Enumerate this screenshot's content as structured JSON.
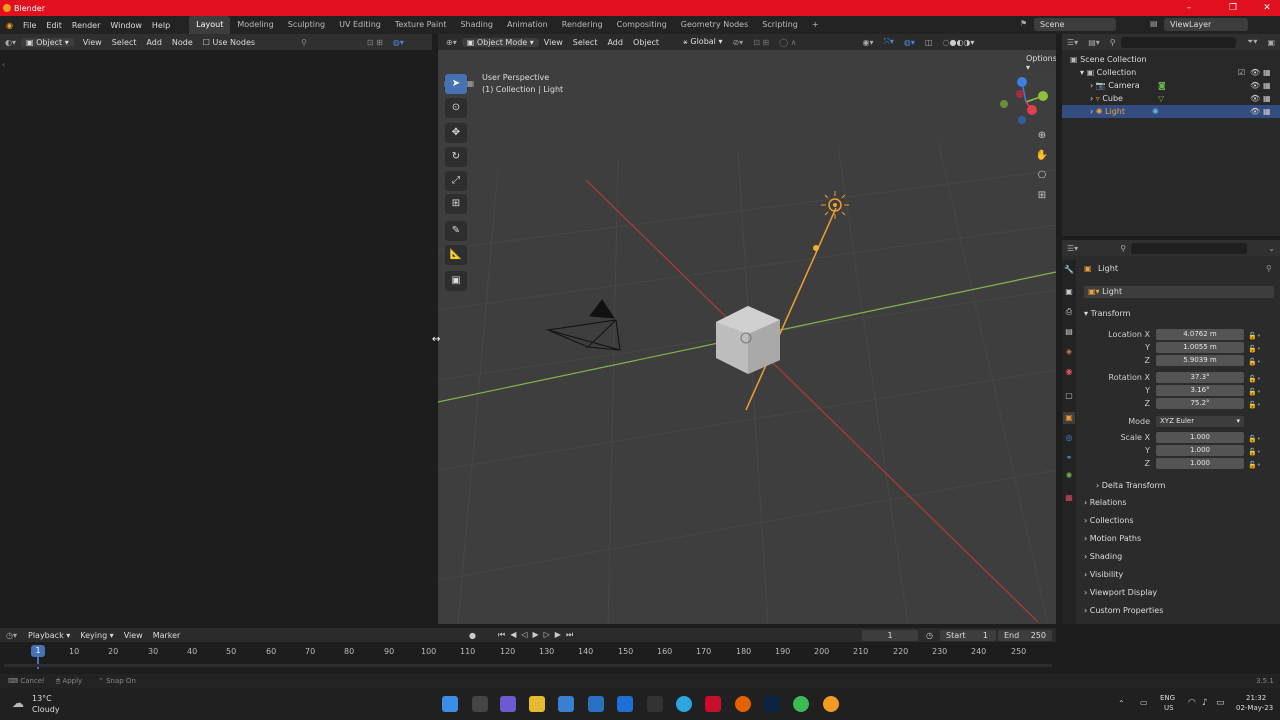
{
  "window": {
    "title": "Blender",
    "minimize": "–",
    "maximize": "❐",
    "close": "✕"
  },
  "menubar": {
    "menus": [
      "File",
      "Edit",
      "Render",
      "Window",
      "Help"
    ],
    "workspaces": [
      "Layout",
      "Modeling",
      "Sculpting",
      "UV Editing",
      "Texture Paint",
      "Shading",
      "Animation",
      "Rendering",
      "Compositing",
      "Geometry Nodes",
      "Scripting"
    ],
    "add_workspace": "+",
    "scene": "Scene",
    "view_layer": "ViewLayer"
  },
  "node_editor": {
    "object": "Object",
    "menus": [
      "View",
      "Select",
      "Add",
      "Node"
    ],
    "use_nodes": "Use Nodes"
  },
  "viewport": {
    "mode": "Object Mode",
    "menus": [
      "View",
      "Select",
      "Add",
      "Object"
    ],
    "orientation": "Global",
    "options": "Options",
    "perspective": "User Perspective",
    "collection_info": "(1) Collection | Light"
  },
  "outliner": {
    "rows": [
      {
        "label": "Scene Collection",
        "icon": "scene-collection-icon"
      },
      {
        "label": "Collection",
        "icon": "collection-icon"
      },
      {
        "label": "Camera",
        "icon": "camera-icon"
      },
      {
        "label": "Cube",
        "icon": "mesh-icon"
      },
      {
        "label": "Light",
        "icon": "light-icon"
      }
    ]
  },
  "properties": {
    "object_name": "Light",
    "datablock": "Light",
    "transform_title": "Transform",
    "location_label": "Location X",
    "location": [
      "4.0762 m",
      "1.0055 m",
      "5.9039 m"
    ],
    "rotation_label": "Rotation X",
    "rotation": [
      "37.3°",
      "3.16°",
      "75.2°"
    ],
    "mode_label": "Mode",
    "mode_value": "XYZ Euler",
    "scale_label": "Scale X",
    "scale": [
      "1.000",
      "1.000",
      "1.000"
    ],
    "axis_y": "Y",
    "axis_z": "Z",
    "delta_transform": "Delta Transform",
    "panels": [
      "Relations",
      "Collections",
      "Motion Paths",
      "Shading",
      "Visibility",
      "Viewport Display",
      "Custom Properties"
    ]
  },
  "timeline": {
    "menus": [
      "Playback",
      "Keying",
      "View",
      "Marker"
    ],
    "current_frame": "1",
    "start_label": "Start",
    "start": "1",
    "end_label": "End",
    "end": "250",
    "ticks": [
      "10",
      "20",
      "30",
      "40",
      "50",
      "60",
      "70",
      "80",
      "90",
      "100",
      "110",
      "120",
      "130",
      "140",
      "150",
      "160",
      "170",
      "180",
      "190",
      "200",
      "210",
      "220",
      "230",
      "240",
      "250"
    ]
  },
  "status": {
    "items": [
      "Cancel",
      "Apply",
      "Snap On"
    ],
    "version": "3.5.1"
  },
  "taskbar": {
    "temp": "13°C",
    "weather": "Cloudy",
    "lang1": "ENG",
    "lang2": "US",
    "time": "21:32",
    "date": "02-May-23"
  }
}
